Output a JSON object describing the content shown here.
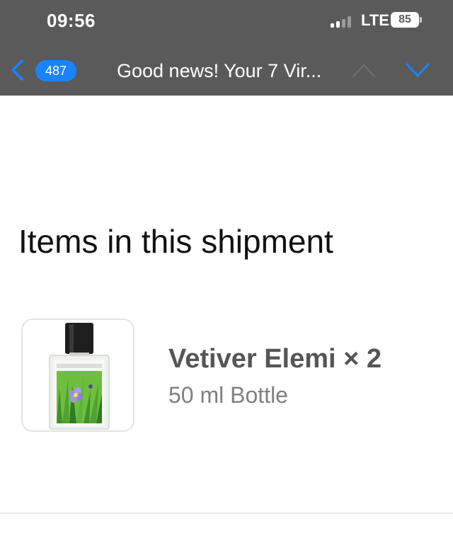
{
  "status_bar": {
    "time": "09:56",
    "network": "LTE",
    "battery": "85"
  },
  "nav_bar": {
    "unread_count": "487",
    "subject": "Good news! Your 7 Vir..."
  },
  "email": {
    "section_heading": "Items in this shipment",
    "items": [
      {
        "name": "Vetiver Elemi × 2",
        "variant": "50 ml Bottle",
        "image": "perfume-bottle-image"
      }
    ]
  },
  "colors": {
    "top_bar": "#5a5a5a",
    "accent_blue": "#1a84ff",
    "heading_text": "#111111",
    "product_name": "#555555",
    "product_variant": "#808080"
  }
}
